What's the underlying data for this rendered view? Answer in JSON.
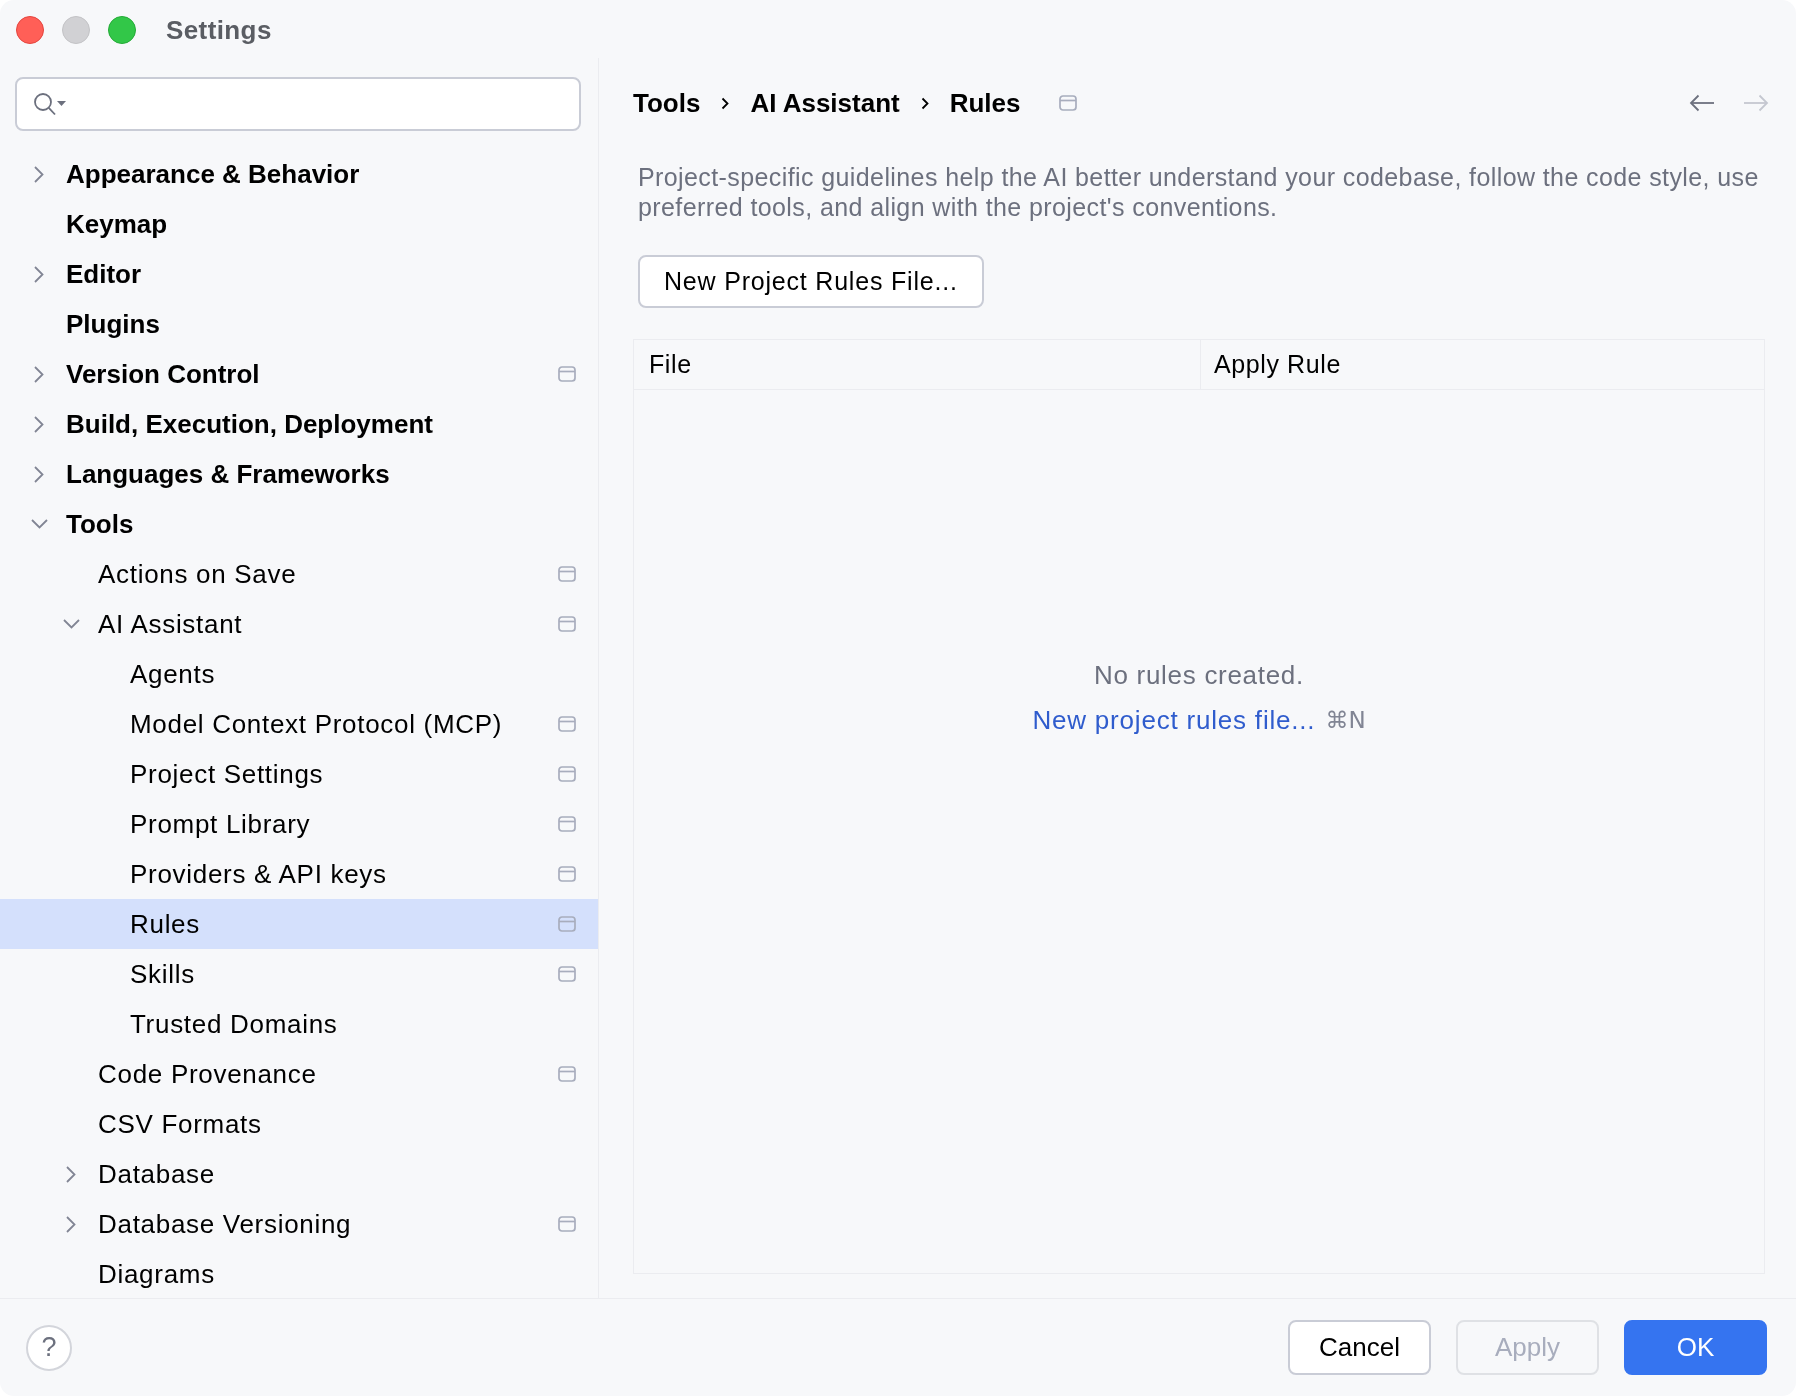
{
  "window": {
    "title": "Settings",
    "controls": [
      {
        "kind": "close",
        "disabled": false
      },
      {
        "kind": "minimize",
        "disabled": true
      },
      {
        "kind": "zoom",
        "disabled": false
      }
    ]
  },
  "sidebar": {
    "items": [
      {
        "label": "Appearance & Behavior",
        "kind": "group",
        "expanded": false,
        "selected": false,
        "project_scoped": false
      },
      {
        "label": "Keymap",
        "kind": "page",
        "selected": false,
        "project_scoped": false
      },
      {
        "label": "Editor",
        "kind": "group",
        "expanded": false,
        "selected": false,
        "project_scoped": false
      },
      {
        "label": "Plugins",
        "kind": "page",
        "selected": false,
        "project_scoped": false
      },
      {
        "label": "Version Control",
        "kind": "group",
        "expanded": false,
        "selected": false,
        "project_scoped": true
      },
      {
        "label": "Build, Execution, Deployment",
        "kind": "group",
        "expanded": false,
        "selected": false,
        "project_scoped": false
      },
      {
        "label": "Languages & Frameworks",
        "kind": "group",
        "expanded": false,
        "selected": false,
        "project_scoped": false
      },
      {
        "label": "Tools",
        "kind": "group",
        "expanded": true,
        "selected": false,
        "project_scoped": false,
        "children": [
          {
            "label": "Actions on Save",
            "kind": "page",
            "selected": false,
            "project_scoped": true
          },
          {
            "label": "AI Assistant",
            "kind": "group",
            "expanded": true,
            "selected": false,
            "project_scoped": true,
            "children": [
              {
                "label": "Agents",
                "kind": "page",
                "selected": false,
                "project_scoped": false
              },
              {
                "label": "Model Context Protocol (MCP)",
                "kind": "page",
                "selected": false,
                "project_scoped": true
              },
              {
                "label": "Project Settings",
                "kind": "page",
                "selected": false,
                "project_scoped": true
              },
              {
                "label": "Prompt Library",
                "kind": "page",
                "selected": false,
                "project_scoped": true
              },
              {
                "label": "Providers & API keys",
                "kind": "page",
                "selected": false,
                "project_scoped": true
              },
              {
                "label": "Rules",
                "kind": "page",
                "selected": true,
                "project_scoped": true
              },
              {
                "label": "Skills",
                "kind": "page",
                "selected": false,
                "project_scoped": true
              },
              {
                "label": "Trusted Domains",
                "kind": "page",
                "selected": false,
                "project_scoped": false
              }
            ]
          },
          {
            "label": "Code Provenance",
            "kind": "page",
            "selected": false,
            "project_scoped": true
          },
          {
            "label": "CSV Formats",
            "kind": "page",
            "selected": false,
            "project_scoped": false
          },
          {
            "label": "Database",
            "kind": "group",
            "expanded": false,
            "selected": false,
            "project_scoped": false
          },
          {
            "label": "Database Versioning",
            "kind": "group",
            "expanded": false,
            "selected": false,
            "project_scoped": true
          },
          {
            "label": "Diagrams",
            "kind": "page",
            "selected": false,
            "project_scoped": false
          }
        ]
      }
    ]
  },
  "page": {
    "breadcrumb": [
      "Tools",
      "AI Assistant",
      "Rules"
    ],
    "project_scoped": true,
    "navigation": [
      {
        "kind": "back",
        "disabled": false
      },
      {
        "kind": "forward",
        "disabled": true
      }
    ],
    "description": "Project-specific guidelines help the AI better understand your codebase, follow the code style, use preferred tools, and align with the project's conventions.",
    "new_button": "New Project Rules File...",
    "table": {
      "columns": [
        "File",
        "Apply Rule"
      ],
      "empty_text": "No rules created.",
      "empty_link": "New project rules file...",
      "empty_shortcut": "⌘N"
    }
  },
  "footer": {
    "help": "?",
    "buttons": [
      {
        "kind": "cancel",
        "label": "Cancel",
        "disabled": false
      },
      {
        "kind": "apply",
        "label": "Apply",
        "disabled": true
      },
      {
        "kind": "ok",
        "label": "OK",
        "disabled": false
      }
    ]
  }
}
